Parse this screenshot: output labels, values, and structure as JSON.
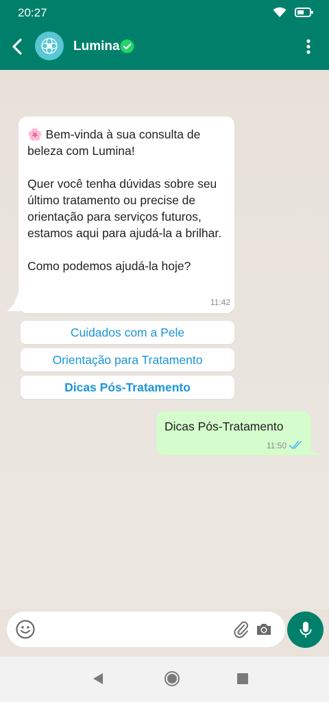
{
  "status_bar": {
    "time": "20:27",
    "icons": [
      "wifi-icon",
      "battery-icon"
    ]
  },
  "header": {
    "contact_name": "Lumina",
    "verified": true,
    "icons": [
      "back-arrow-icon",
      "lumina-logo-icon",
      "verified-badge-icon",
      "more-vert-icon"
    ]
  },
  "messages": [
    {
      "direction": "incoming",
      "text": "🌸 Bem-vinda à sua consulta de beleza com Lumina!\n\nQuer você tenha dúvidas sobre seu último tratamento ou precise de orientação para serviços futuros, estamos aqui para ajudá-la a brilhar.\n\nComo podemos ajudá-la hoje?",
      "time": "11:42"
    },
    {
      "direction": "outgoing",
      "text": "Dicas Pós-Tratamento",
      "time": "11:50",
      "status": "read"
    }
  ],
  "quick_replies": [
    {
      "label": "Cuidados com a Pele",
      "selected": false
    },
    {
      "label": "Orientação para Tratamento",
      "selected": false
    },
    {
      "label": "Dicas Pós-Tratamento",
      "selected": true
    }
  ],
  "composer": {
    "placeholder": "",
    "icons": [
      "emoji-icon",
      "paperclip-icon",
      "camera-icon",
      "microphone-icon"
    ]
  },
  "nav_bar": {
    "icons": [
      "nav-back-icon",
      "nav-home-icon",
      "nav-recents-icon"
    ]
  },
  "colors": {
    "header": "#00806a",
    "chat_background": "#e9e3dc",
    "incoming_bubble": "#ffffff",
    "outgoing_bubble": "#d4fccc",
    "quick_reply_text": "#1b95d8",
    "read_ticks": "#4fb6ec",
    "avatar": "#58c6d4"
  }
}
